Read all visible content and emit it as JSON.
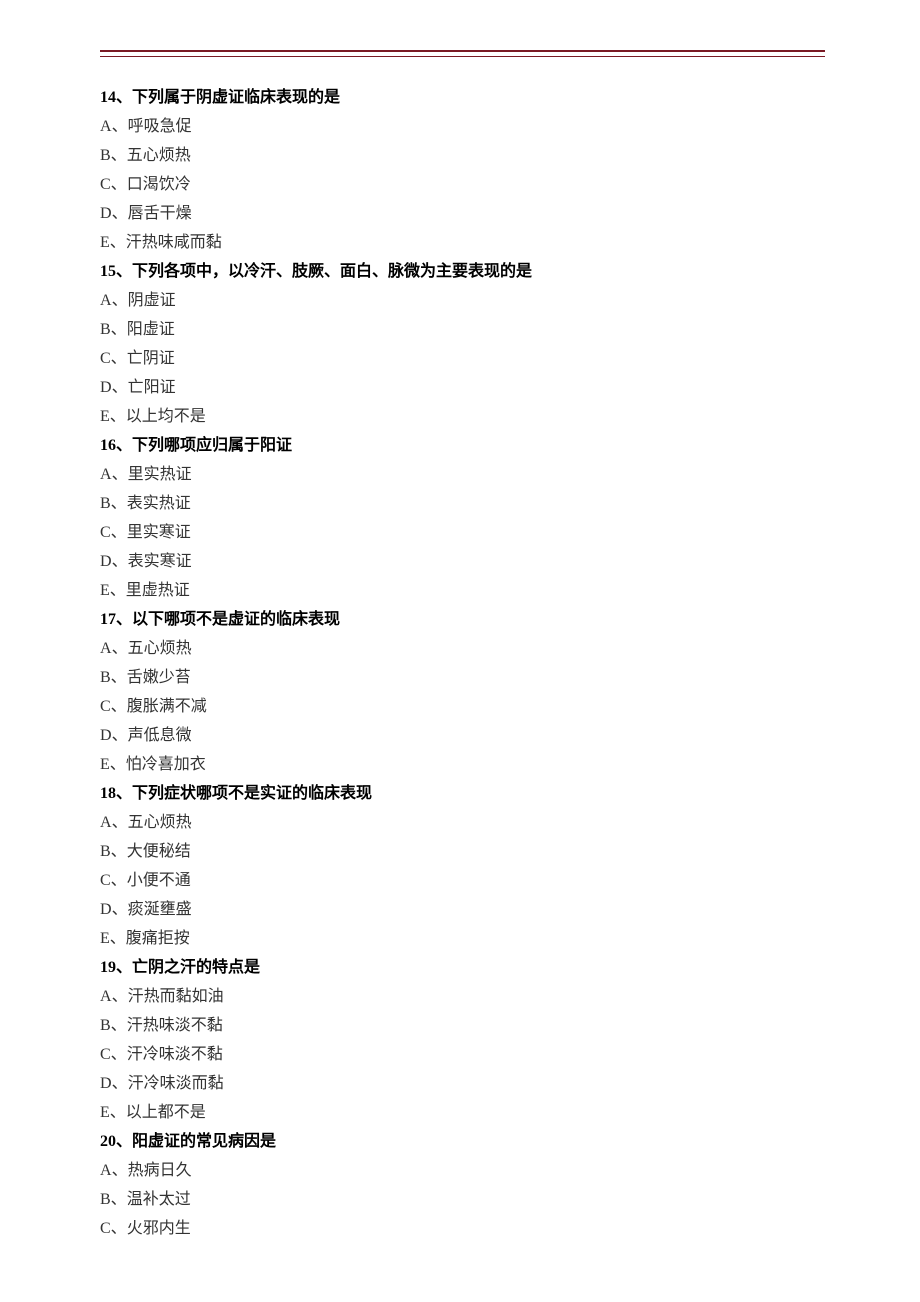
{
  "questions": [
    {
      "number": "14",
      "title": "、下列属于阴虚证临床表现的是",
      "options": [
        {
          "label": "A",
          "text": "呼吸急促"
        },
        {
          "label": "B",
          "text": "五心烦热"
        },
        {
          "label": "C",
          "text": "口渴饮冷"
        },
        {
          "label": "D",
          "text": "唇舌干燥"
        },
        {
          "label": "E",
          "text": "汗热味咸而黏"
        }
      ]
    },
    {
      "number": "15",
      "title": "、下列各项中，以冷汗、肢厥、面白、脉微为主要表现的是",
      "options": [
        {
          "label": "A",
          "text": "阴虚证"
        },
        {
          "label": "B",
          "text": "阳虚证"
        },
        {
          "label": "C",
          "text": "亡阴证"
        },
        {
          "label": "D",
          "text": "亡阳证"
        },
        {
          "label": "E",
          "text": "以上均不是"
        }
      ]
    },
    {
      "number": "16",
      "title": "、下列哪项应归属于阳证",
      "options": [
        {
          "label": "A",
          "text": "里实热证"
        },
        {
          "label": "B",
          "text": "表实热证"
        },
        {
          "label": "C",
          "text": "里实寒证"
        },
        {
          "label": "D",
          "text": "表实寒证"
        },
        {
          "label": "E",
          "text": "里虚热证"
        }
      ]
    },
    {
      "number": "17",
      "title": "、以下哪项不是虚证的临床表现",
      "options": [
        {
          "label": "A",
          "text": "五心烦热"
        },
        {
          "label": "B",
          "text": "舌嫩少苔"
        },
        {
          "label": "C",
          "text": "腹胀满不减"
        },
        {
          "label": "D",
          "text": "声低息微"
        },
        {
          "label": "E",
          "text": "怕冷喜加衣"
        }
      ]
    },
    {
      "number": "18",
      "title": "、下列症状哪项不是实证的临床表现",
      "options": [
        {
          "label": "A",
          "text": "五心烦热"
        },
        {
          "label": "B",
          "text": "大便秘结"
        },
        {
          "label": "C",
          "text": "小便不通"
        },
        {
          "label": "D",
          "text": "痰涎壅盛"
        },
        {
          "label": "E",
          "text": "腹痛拒按"
        }
      ]
    },
    {
      "number": "19",
      "title": "、亡阴之汗的特点是",
      "options": [
        {
          "label": "A",
          "text": "汗热而黏如油"
        },
        {
          "label": "B",
          "text": "汗热味淡不黏"
        },
        {
          "label": "C",
          "text": "汗冷味淡不黏"
        },
        {
          "label": "D",
          "text": "汗冷味淡而黏"
        },
        {
          "label": "E",
          "text": "以上都不是"
        }
      ]
    },
    {
      "number": "20",
      "title": "、阳虚证的常见病因是",
      "options": [
        {
          "label": "A",
          "text": "热病日久"
        },
        {
          "label": "B",
          "text": "温补太过"
        },
        {
          "label": "C",
          "text": "火邪内生"
        }
      ]
    }
  ]
}
